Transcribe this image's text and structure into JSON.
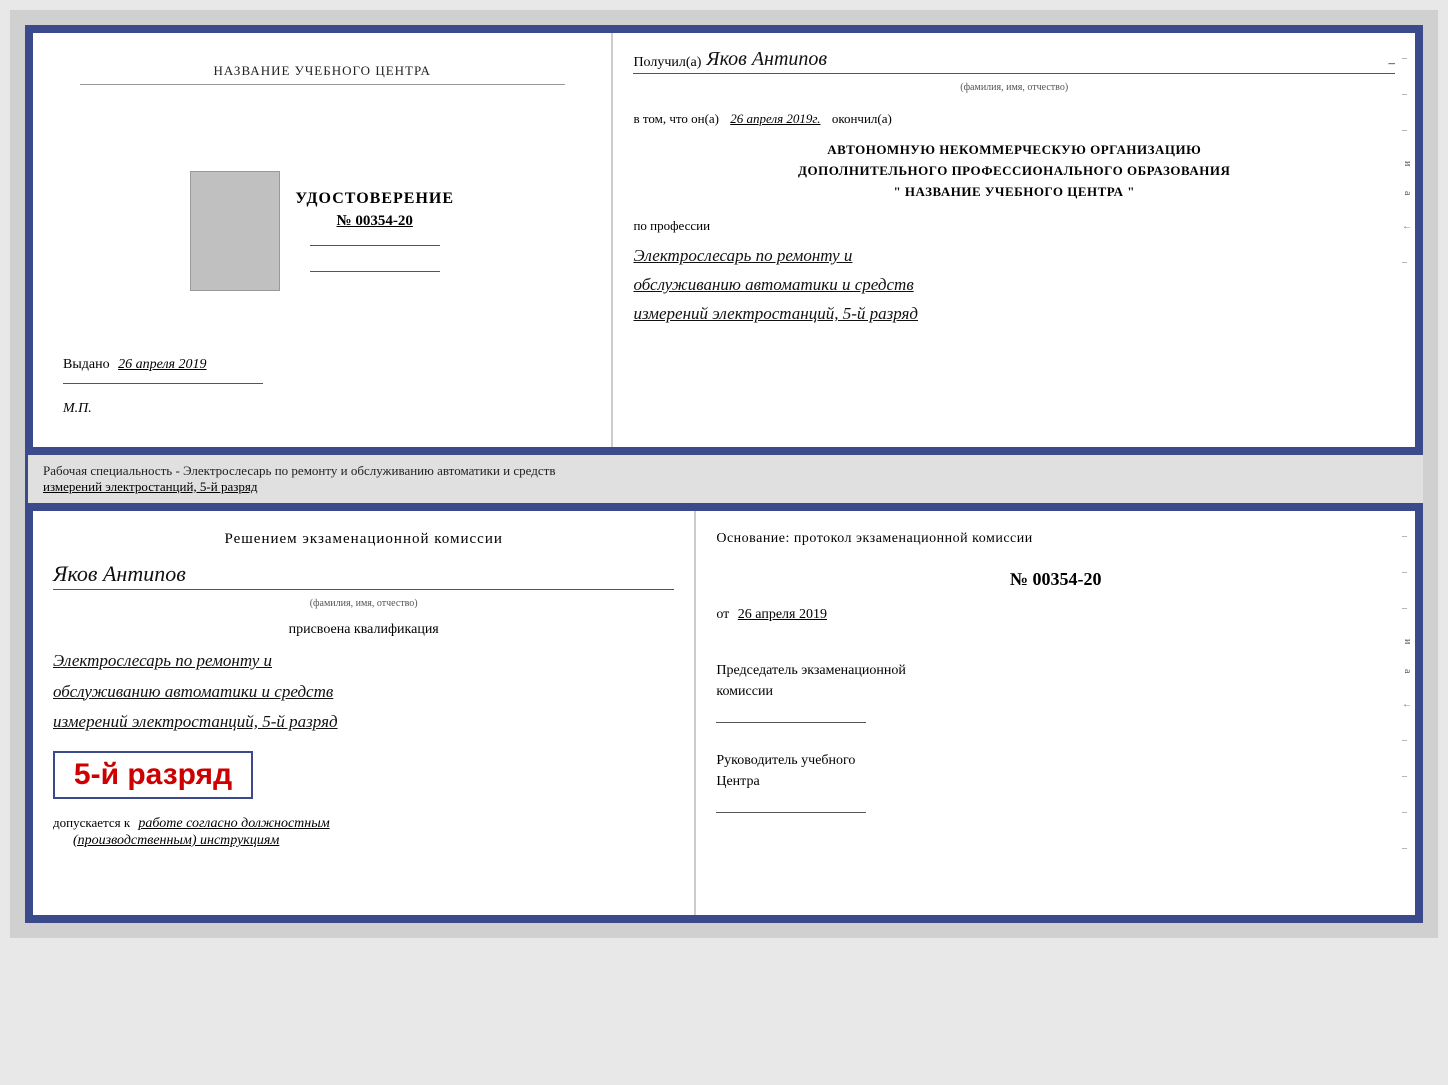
{
  "topDoc": {
    "left": {
      "trainingCenterLabel": "НАЗВАНИЕ УЧЕБНОГО ЦЕНТРА",
      "udostTitle": "УДОСТОВЕРЕНИЕ",
      "udostNumber": "№ 00354-20",
      "vydanoLabel": "Выдано",
      "vydanoDate": "26 апреля 2019",
      "mpLabel": "М.П."
    },
    "right": {
      "poluchilLabel": "Получил(а)",
      "recipientName": "Яков Антипов",
      "fioSubLabel": "(фамилия, имя, отчество)",
      "vtomLabel": "в том, что он(а)",
      "vtomDate": "26 апреля 2019г.",
      "okonchilLabel": "окончил(а)",
      "anoLine1": "АВТОНОМНУЮ НЕКОММЕРЧЕСКУЮ ОРГАНИЗАЦИЮ",
      "anoLine2": "ДОПОЛНИТЕЛЬНОГО ПРОФЕССИОНАЛЬНОГО ОБРАЗОВАНИЯ",
      "anoLine3": "\"    НАЗВАНИЕ УЧЕБНОГО ЦЕНТРА    \"",
      "poProf": "по профессии",
      "profText1": "Электрослесарь по ремонту и",
      "profText2": "обслуживанию автоматики и средств",
      "profText3": "измерений электростанций, 5-й разряд"
    }
  },
  "middleText": {
    "line1": "Рабочая специальность - Электрослесарь по ремонту и обслуживанию автоматики и средств",
    "line2": "измерений электростанций, 5-й разряд"
  },
  "bottomDoc": {
    "left": {
      "resheniemTitle": "Решением экзаменационной комиссии",
      "recipientName": "Яков Антипов",
      "fioSubLabel": "(фамилия, имя, отчество)",
      "prisvoenaLabel": "присвоена квалификация",
      "qualLine1": "Электрослесарь по ремонту и",
      "qualLine2": "обслуживанию автоматики и средств",
      "qualLine3": "измерений электростанций, 5-й разряд",
      "razryadBadge": "5-й разряд",
      "dopuskaetsyaLabel": "допускается к",
      "dopuskaetsyaText": "работе согласно должностным",
      "dopuskaetsyaText2": "(производственным) инструкциям"
    },
    "right": {
      "osnovanieTitleLabel": "Основание: протокол экзаменационной комиссии",
      "protocolNumber": "№ 00354-20",
      "otLabel": "от",
      "otDate": "26 апреля 2019",
      "predsedatelTitle": "Председатель экзаменационной",
      "predsedatelTitle2": "комиссии",
      "rukovoditelTitle": "Руководитель учебного",
      "rukovoditelTitle2": "Центра"
    }
  }
}
